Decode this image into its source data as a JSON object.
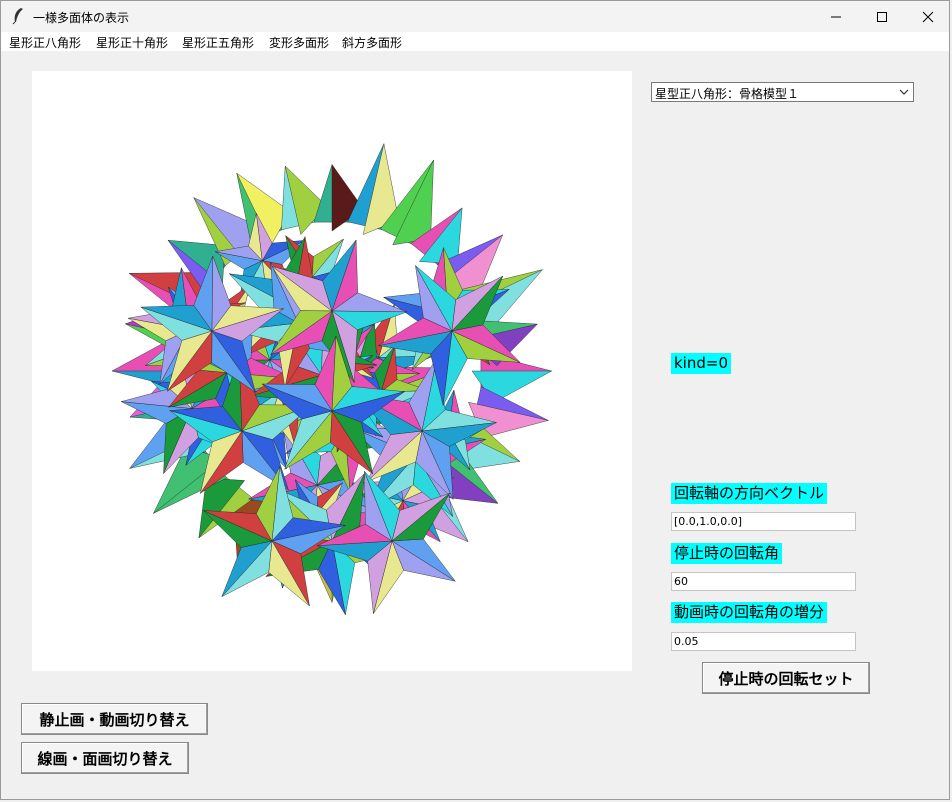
{
  "window": {
    "title": "一様多面体の表示"
  },
  "menu": [
    {
      "label": "星形正八角形"
    },
    {
      "label": "星形正十角形"
    },
    {
      "label": "星形正五角形"
    },
    {
      "label": "変形多面形"
    },
    {
      "label": "斜方多面形"
    }
  ],
  "combo": {
    "selected": "星型正八角形：骨格模型１"
  },
  "kind_label": "kind=0",
  "rotation": {
    "axis_label": "回転軸の方向ベクトル",
    "axis_value": "[0.0,1.0,0.0]",
    "stop_angle_label": "停止時の回転角",
    "stop_angle_value": "60",
    "anim_increment_label": "動画時の回転角の増分",
    "anim_increment_value": "0.05",
    "set_button": "停止時の回転セット"
  },
  "buttons": {
    "toggle_animation": "静止画・動画切り替え",
    "toggle_render": "線画・面画切り替え"
  },
  "palette": [
    "#e84fb4",
    "#f0f060",
    "#2cd8e0",
    "#7a5cf0",
    "#1a9a3a",
    "#c030d0",
    "#a0d040",
    "#f090d0",
    "#3060e0",
    "#40c070",
    "#d04040",
    "#5a1a1a",
    "#80e0e0",
    "#c8c040",
    "#60a0f0",
    "#30b090",
    "#e8e890",
    "#8040c0",
    "#20a0d0",
    "#e060e0",
    "#a0a0f0",
    "#50d050",
    "#d0a0e0",
    "#9a4a20"
  ]
}
